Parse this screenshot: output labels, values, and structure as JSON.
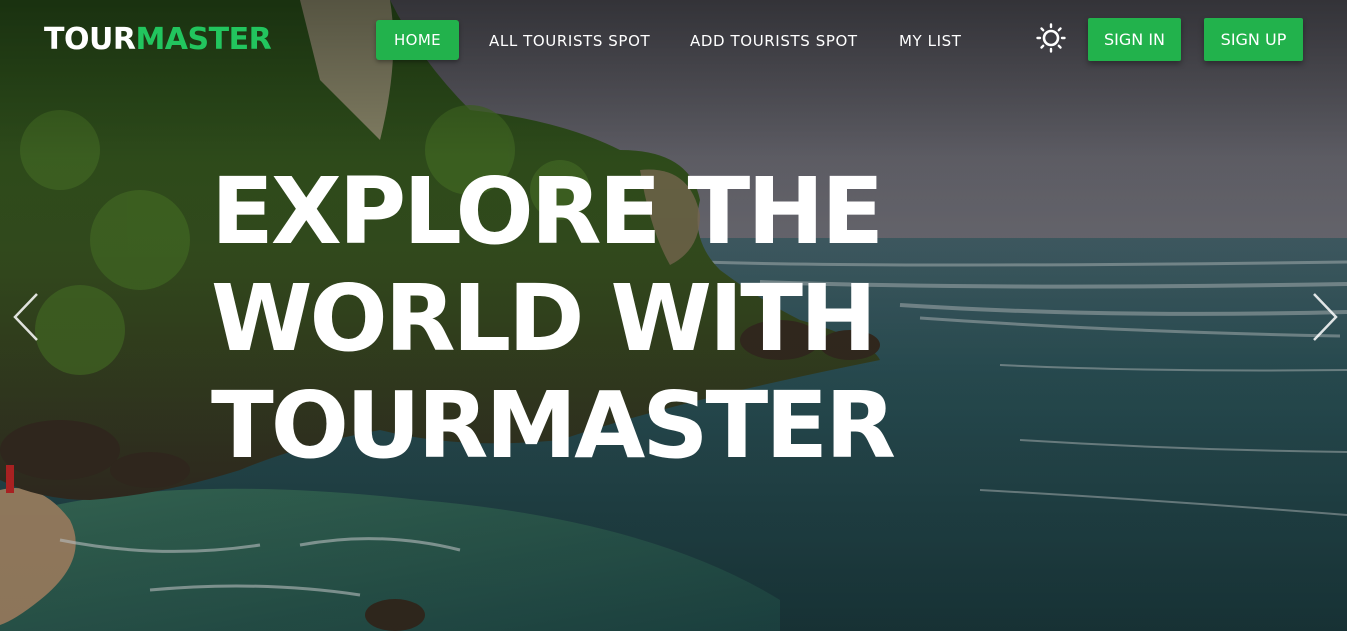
{
  "logo": {
    "part1": "TOUR",
    "part2": "MASTER"
  },
  "nav": {
    "home": "HOME",
    "all_spots": "ALL TOURISTS SPOT",
    "add_spot": "ADD TOURISTS SPOT",
    "my_list": "MY LIST"
  },
  "theme_toggle": {
    "icon": "sun-icon"
  },
  "auth": {
    "sign_in": "SIGN IN",
    "sign_up": "SIGN UP"
  },
  "hero": {
    "line1": "EXPLORE THE",
    "line2": "WORLD WITH",
    "line3": "TOURMASTER"
  },
  "carousel": {
    "prev_icon": "chevron-left-icon",
    "next_icon": "chevron-right-icon"
  },
  "colors": {
    "accent": "#22b24c",
    "logo_green": "#22c55e",
    "text": "#ffffff"
  }
}
